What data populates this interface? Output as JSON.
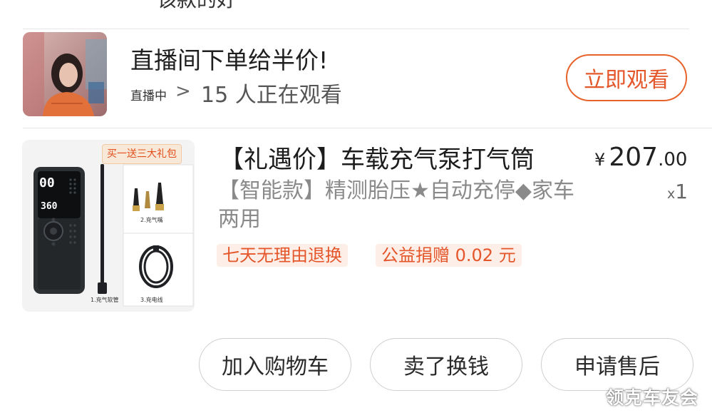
{
  "top_cut_text": "该款的好",
  "live": {
    "title": "直播间下单给半价!",
    "status": "直播中",
    "chevron": ">",
    "viewers": "15 人正在观看",
    "watch_button": "立即观看",
    "accent_color": "#e4572a"
  },
  "product": {
    "badge": "买一送三大礼包",
    "image_labels": {
      "hose": "1.充气软管",
      "nozzle": "2.充气嘴",
      "cable": "3.充电线"
    },
    "device_readings": {
      "top": "00",
      "bottom": "360"
    },
    "title": "【礼遇价】车载充气泵打气筒",
    "spec": "【智能款】精测胎压★自动充停◆家车两用",
    "price_currency": "¥",
    "price_integer": "207",
    "price_decimal": ".00",
    "qty_prefix": "x",
    "qty_value": "1",
    "tags": [
      "七天无理由退换",
      "公益捐赠 0.02 元"
    ]
  },
  "actions": {
    "add_to_cart": "加入购物车",
    "resell": "卖了换钱",
    "after_sales": "申请售后"
  },
  "watermark": "领克车友会",
  "icons": {
    "live_chevron": "chevron-right-icon"
  }
}
